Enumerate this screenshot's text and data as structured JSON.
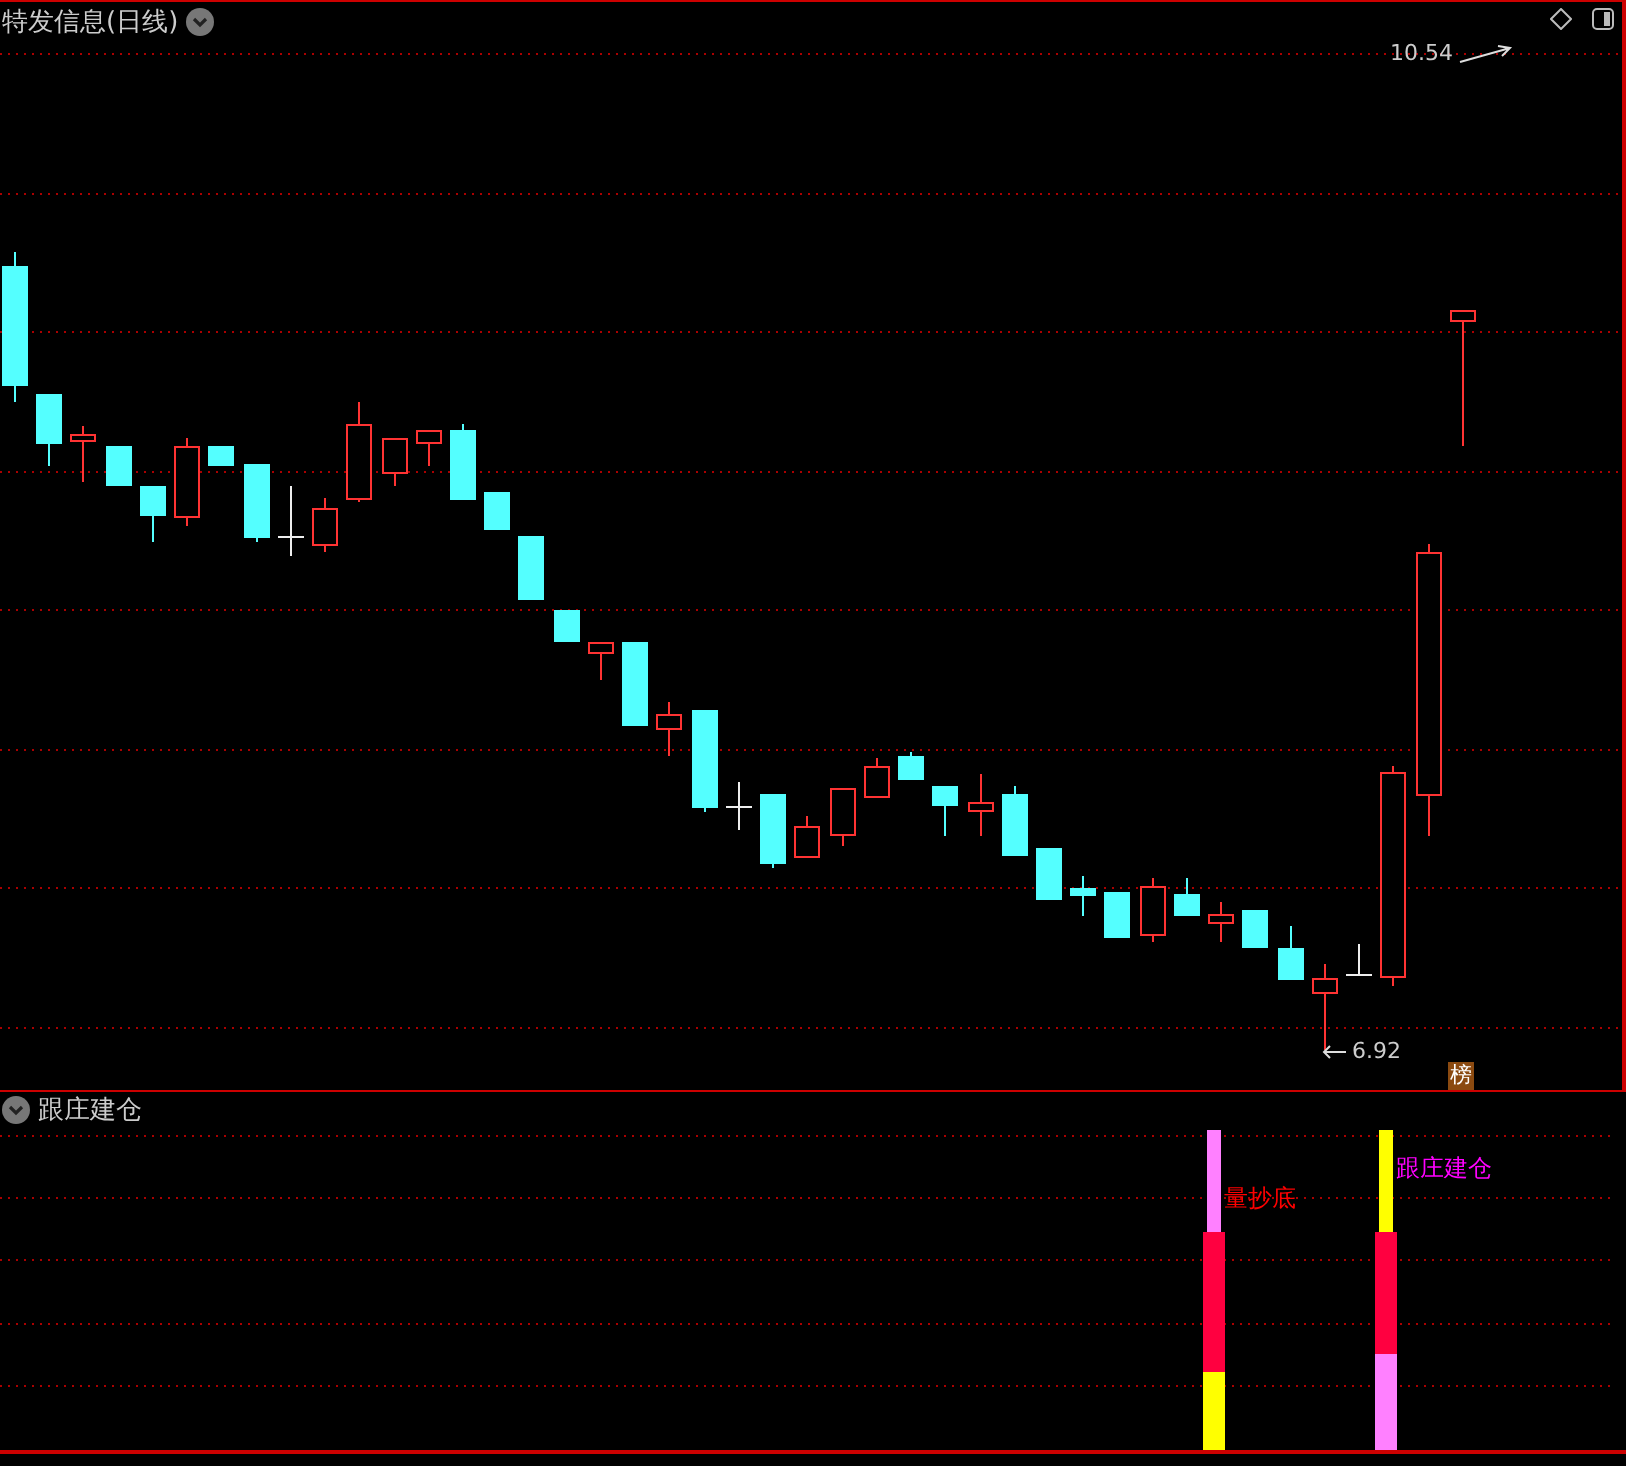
{
  "main_panel": {
    "title": "特发信息(日线)",
    "high_marker": "10.54",
    "low_marker": "6.92",
    "badge": "榜"
  },
  "indicator_panel": {
    "title": "跟庄建仓",
    "signals": [
      {
        "label": "量抄底",
        "color": "#ff0000"
      },
      {
        "label": "跟庄建仓",
        "color": "#ff00ff"
      }
    ]
  }
}
